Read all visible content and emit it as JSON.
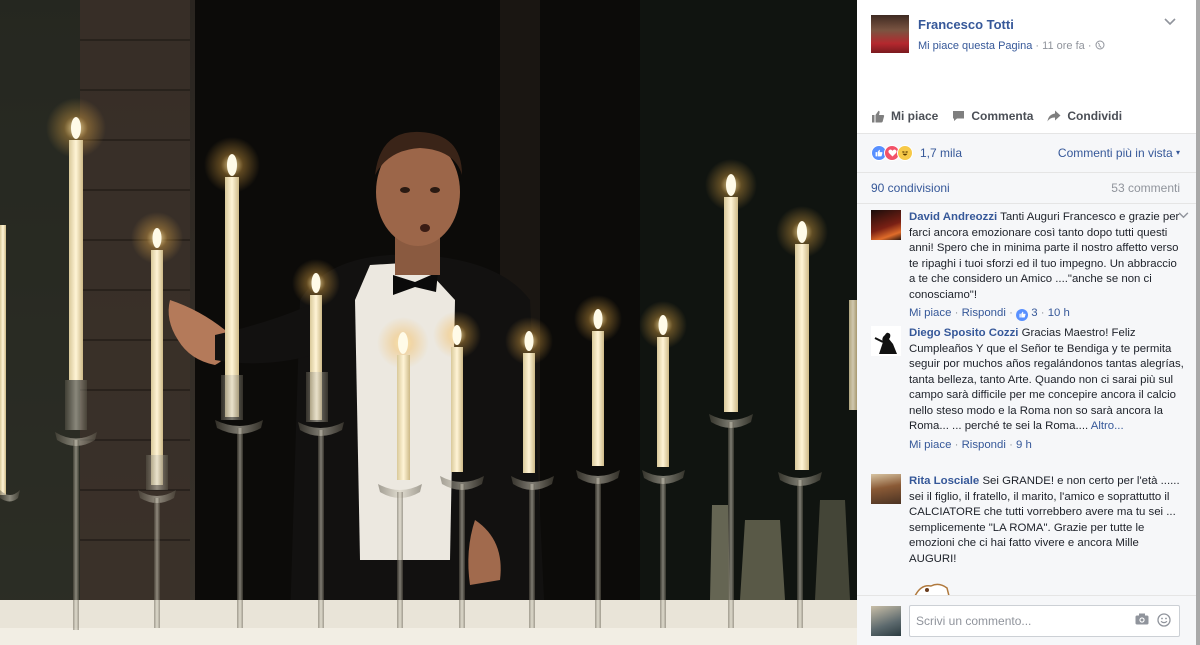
{
  "post": {
    "page_name": "Francesco Totti",
    "like_page": "Mi piace questa Pagina",
    "time": "11 ore fa",
    "separator": "·"
  },
  "actions": {
    "like": "Mi piace",
    "comment": "Commenta",
    "share": "Condividi"
  },
  "reactions": {
    "count": "1,7 mila",
    "icons": [
      "like-icon",
      "love-icon",
      "haha-icon"
    ],
    "sort": "Commenti più in vista"
  },
  "stats": {
    "shares": "90 condivisioni",
    "comments": "53 commenti"
  },
  "comments": [
    {
      "author": "David Andreozzi",
      "text": "Tanti Auguri Francesco e grazie per farci ancora emozionare così tanto dopo tutti questi anni! Spero che in minima parte il nostro affetto verso te ripaghi i tuoi sforzi ed il tuo impegno. Un abbraccio a te che considero un Amico ....\"anche se non ci conosciamo\"!",
      "like": "Mi piace",
      "reply": "Rispondi",
      "likes": "3",
      "time": "10 h"
    },
    {
      "author": "Diego Sposito Cozzi",
      "text": "Gracias Maestro! Feliz Cumpleaños Y que el Señor te Bendiga y te permita seguir por muchos años regalándonos tantas alegrías, tanta belleza, tanto Arte. Quando non ci sarai più sul campo sarà difficile per me concepire ancora il calcio nello steso modo e la Roma non so sarà ancora la Roma... ... perché te sei la Roma....",
      "more": "Altro...",
      "like": "Mi piace",
      "reply": "Rispondi",
      "time": "9 h"
    },
    {
      "author": "Rita Losciale",
      "text": "Sei GRANDE! e non certo per l'età ...... sei il figlio, il fratello, il marito, l'amico e soprattutto il CALCIATORE che tutti vorrebbero avere ma tu sei ... semplicemente \"LA ROMA\". Grazie per tutte le emozioni che ci hai fatto vivere e ancora Mille AUGURI!"
    }
  ],
  "composer": {
    "placeholder": "Scrivi un commento..."
  },
  "colors": {
    "link": "#365899",
    "muted": "#90949c",
    "panel_bg": "#f6f7f9"
  }
}
